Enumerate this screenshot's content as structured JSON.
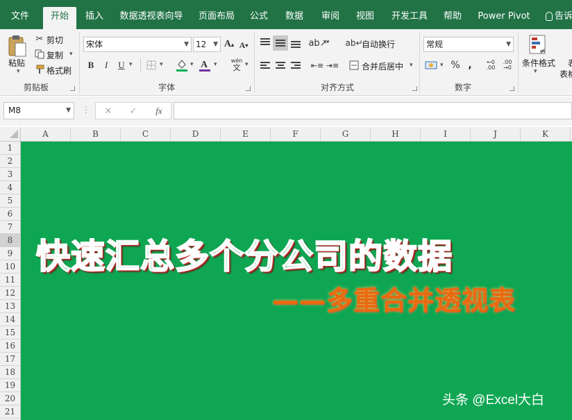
{
  "tabs": [
    "文件",
    "开始",
    "插入",
    "数据透视表向导",
    "页面布局",
    "公式",
    "数据",
    "审阅",
    "视图",
    "开发工具",
    "帮助",
    "Power Pivot"
  ],
  "tell_me": "告诉",
  "clipboard": {
    "paste": "粘贴",
    "cut": "剪切",
    "copy": "复制",
    "format_painter": "格式刷",
    "group": "剪贴板"
  },
  "font": {
    "name": "宋体",
    "size": "12",
    "bold": "B",
    "italic": "I",
    "underline": "U",
    "grow": "A",
    "shrink": "A",
    "phonetic_top": "wén",
    "phonetic_bottom": "文",
    "group": "字体",
    "fill_color": "#00b050",
    "font_color": "#7030a0"
  },
  "alignment": {
    "wrap": "自动换行",
    "merge": "合并后居中",
    "group": "对齐方式"
  },
  "number": {
    "format": "常规",
    "percent": "%",
    "comma": ",",
    "inc": ".00",
    "dec": ".00",
    "group": "数字"
  },
  "styles": {
    "conditional": "条件格式",
    "table_a": "表",
    "table_b": "表格"
  },
  "formula_bar": {
    "name_box": "M8",
    "fx": "fx",
    "value": ""
  },
  "columns": [
    "A",
    "B",
    "C",
    "D",
    "E",
    "F",
    "G",
    "H",
    "I",
    "J",
    "K"
  ],
  "rows": [
    "1",
    "2",
    "3",
    "4",
    "5",
    "6",
    "7",
    "8",
    "9",
    "10",
    "11",
    "12",
    "13",
    "14",
    "15",
    "16",
    "17",
    "18",
    "19",
    "20",
    "21"
  ],
  "selected_row": "8",
  "content": {
    "title": "快速汇总多个分公司的数据",
    "subtitle": "——多重合并透视表",
    "watermark": "头条 @Excel大白",
    "bg_color": "#0fa653"
  }
}
